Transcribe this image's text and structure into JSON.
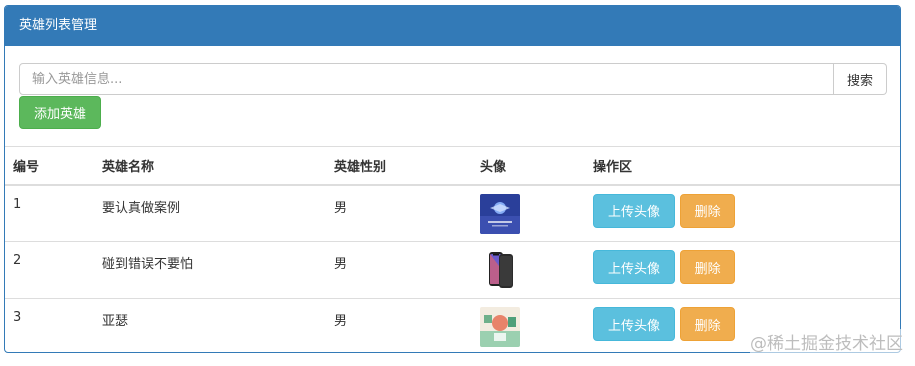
{
  "panel": {
    "title": "英雄列表管理"
  },
  "search": {
    "placeholder": "输入英雄信息...",
    "button_label": "搜索"
  },
  "add_button": {
    "label": "添加英雄"
  },
  "table": {
    "headers": [
      "编号",
      "英雄名称",
      "英雄性别",
      "头像",
      "操作区"
    ],
    "rows": [
      {
        "id": "1",
        "name": "要认真做案例",
        "gender": "男",
        "avatar_icon": "blue-poster-image",
        "upload_label": "上传头像",
        "delete_label": "删除"
      },
      {
        "id": "2",
        "name": "碰到错误不要怕",
        "gender": "男",
        "avatar_icon": "phone-image",
        "upload_label": "上传头像",
        "delete_label": "删除"
      },
      {
        "id": "3",
        "name": "亚瑟",
        "gender": "男",
        "avatar_icon": "green-illustration-image",
        "upload_label": "上传头像",
        "delete_label": "删除"
      }
    ]
  },
  "watermark": "@稀土掘金技术社区",
  "colors": {
    "primary": "#337ab7",
    "success": "#5cb85c",
    "info": "#5bc0de",
    "warning": "#f0ad4e"
  }
}
